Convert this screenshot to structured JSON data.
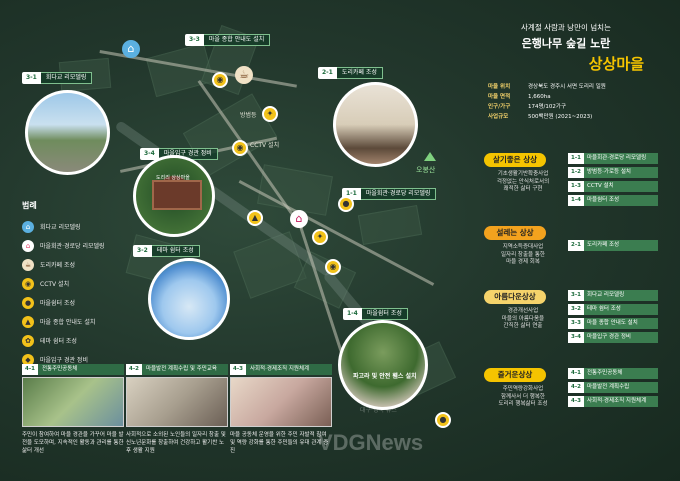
{
  "header": {
    "subtitle": "사계절 사람과 낭만이 넘치는",
    "title": "은행나무 숲길 노란",
    "village_name": "상상마을"
  },
  "info": [
    {
      "key": "마을 위치",
      "value": "경상북도 경주시 서면 도리리 일원"
    },
    {
      "key": "마을 면적",
      "value": "1,660ha"
    },
    {
      "key": "인구/가구",
      "value": "174명/102가구"
    },
    {
      "key": "사업규모",
      "value": "500백만원 (2021~2023)"
    }
  ],
  "sections": [
    {
      "name": "살기좋은 상상",
      "color": "#f5c400",
      "note": "기초생활기반확충사업\n걱정없는 안식처로서의\n쾌적한 삶터 구현",
      "items": [
        {
          "n": "1-1",
          "t": "마을회관·경로당 리모델링"
        },
        {
          "n": "1-2",
          "t": "방범등·가로등 설치"
        },
        {
          "n": "1-3",
          "t": "CCTV 설치"
        },
        {
          "n": "1-4",
          "t": "마을쉼터 조성"
        }
      ]
    },
    {
      "name": "설레는 상상",
      "color": "#f3a21e",
      "note": "지역소득증대사업\n일자리 창출을 통한\n마을 경제 회복",
      "items": [
        {
          "n": "2-1",
          "t": "도리카페 조성"
        }
      ]
    },
    {
      "name": "아름다운상상",
      "color": "#f5d36b",
      "note": "경관개선사업\n마을의 아름다움을\n간직한 삶터 연출",
      "items": [
        {
          "n": "3-1",
          "t": "회다교 리모델링"
        },
        {
          "n": "3-2",
          "t": "테마 쉼터 조성"
        },
        {
          "n": "3-3",
          "t": "마을 종합 안내도 설치"
        },
        {
          "n": "3-4",
          "t": "마을입구 경관 정비"
        }
      ]
    },
    {
      "name": "즐거운상상",
      "color": "#f5c400",
      "note": "주민역량강화사업\n함께사서 더 행복한\n도리리 행복삶터 조성",
      "items": [
        {
          "n": "4-1",
          "t": "전통주민공동체"
        },
        {
          "n": "4-2",
          "t": "마을발전 계획수립"
        },
        {
          "n": "4-3",
          "t": "사회적·경제조직 지원체계"
        }
      ]
    }
  ],
  "legend": {
    "head": "범례",
    "items": [
      {
        "icon": "bridge-icon",
        "label": "회다교 리모델링",
        "color": "#5bb0e0"
      },
      {
        "icon": "home-icon",
        "label": "마을회관·경로당 리모델링",
        "color": "#e0476d"
      },
      {
        "icon": "cafe-icon",
        "label": "도리카페 조성",
        "color": "#c8a15a"
      },
      {
        "icon": "cctv-icon",
        "label": "CCTV 설치",
        "color": "#f2c21a"
      },
      {
        "icon": "rest-icon",
        "label": "마을쉼터 조성",
        "color": "#f2c21a"
      },
      {
        "icon": "signboard-icon",
        "label": "마을 종합 안내도 설치",
        "color": "#f2c21a"
      },
      {
        "icon": "theme-rest-icon",
        "label": "테마 쉼터 조성",
        "color": "#f2c21a"
      },
      {
        "icon": "entrance-icon",
        "label": "마을입구 경관 정비",
        "color": "#f2c21a"
      }
    ]
  },
  "map_tags": [
    {
      "n": "3-3",
      "t": "마을 종합 안내도 설치"
    },
    {
      "n": "3-1",
      "t": "회다교 리모델링"
    },
    {
      "n": "2-1",
      "t": "도리카페 조성"
    },
    {
      "n": "3-4",
      "t": "마을입구 경관 정비"
    },
    {
      "n": "1-1",
      "t": "마을회관·경로당 리모델링"
    },
    {
      "n": "3-2",
      "t": "테마 쉼터 조성"
    },
    {
      "n": "1-4",
      "t": "마을쉼터 조성"
    }
  ],
  "map_labels": {
    "lamp": "방범등",
    "cctv": "CCTV 설치",
    "fitness": "파고라 및 안전 휀스 설치",
    "peak": "오봉산",
    "mini_sign": "도리리 상상마을"
  },
  "cards": [
    {
      "n": "4-1",
      "t": "전통주민공동체",
      "desc": "주민이 참여하여 마을 경관을 가꾸어 마을 발전을 도모하며, 지속적인 활동과 관리를 통한 삶터 개선"
    },
    {
      "n": "4-2",
      "t": "마을발전 계획수립 및 주민교육",
      "desc": "사회적으로 소외된 노인들의 일자리 창출 및 신노년문화를 창출하여 건강하고 활기찬 노후 생활 지원"
    },
    {
      "n": "4-3",
      "t": "사회적·경제조직 지원체계",
      "desc": "마을 공동체 운영을 위한 주민 자발적 참여 및 역량 강화를 통한 주민들의 유대 관계 증진"
    }
  ],
  "watermark": "VDGNews",
  "watermark_small": "대구·경북 뉴스"
}
